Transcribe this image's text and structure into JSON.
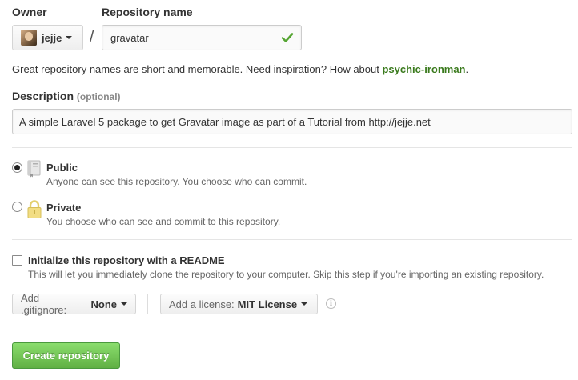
{
  "owner": {
    "label": "Owner",
    "username": "jejje"
  },
  "repository": {
    "label": "Repository name",
    "separator": "/",
    "value": "gravatar",
    "valid": true
  },
  "hint": {
    "text": "Great repository names are short and memorable. Need inspiration? How about ",
    "suggestion": "psychic-ironman",
    "suffix": "."
  },
  "description": {
    "label": "Description",
    "optional": "(optional)",
    "value": "A simple Laravel 5 package to get Gravatar image as part of a Tutorial from http://jejje.net"
  },
  "visibility": {
    "public": {
      "title": "Public",
      "desc": "Anyone can see this repository. You choose who can commit.",
      "checked": true
    },
    "private": {
      "title": "Private",
      "desc": "You choose who can see and commit to this repository.",
      "checked": false
    }
  },
  "readme": {
    "title": "Initialize this repository with a README",
    "desc": "This will let you immediately clone the repository to your computer. Skip this step if you're importing an existing repository.",
    "checked": false
  },
  "gitignore": {
    "label": "Add .gitignore:",
    "value": "None"
  },
  "license": {
    "label": "Add a license:",
    "value": "MIT License"
  },
  "info_icon": "i",
  "create_button": "Create repository",
  "colors": {
    "accent_green": "#60b044",
    "suggestion_green": "#3a7a1d",
    "check_green": "#55a532"
  }
}
